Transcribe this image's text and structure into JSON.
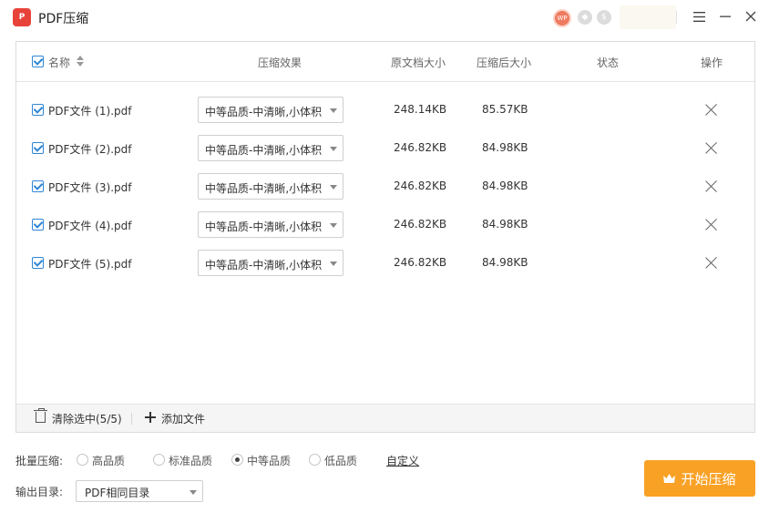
{
  "app": {
    "logo_text": "P",
    "title": "PDF压缩"
  },
  "titlebar": {
    "avatar_text": "WP",
    "menu_icon": "hamburger-icon",
    "minimize_icon": "minimize-icon",
    "close_icon": "close-icon"
  },
  "table": {
    "headers": {
      "name": "名称",
      "effect": "压缩效果",
      "orig_size": "原文档大小",
      "comp_size": "压缩后大小",
      "status": "状态",
      "action": "操作"
    },
    "rows": [
      {
        "name": "PDF文件 (1).pdf",
        "quality": "中等品质-中清晰,小体积",
        "orig": "248.14KB",
        "comp": "85.57KB",
        "status": ""
      },
      {
        "name": "PDF文件 (2).pdf",
        "quality": "中等品质-中清晰,小体积",
        "orig": "246.82KB",
        "comp": "84.98KB",
        "status": ""
      },
      {
        "name": "PDF文件 (3).pdf",
        "quality": "中等品质-中清晰,小体积",
        "orig": "246.82KB",
        "comp": "84.98KB",
        "status": ""
      },
      {
        "name": "PDF文件 (4).pdf",
        "quality": "中等品质-中清晰,小体积",
        "orig": "246.82KB",
        "comp": "84.98KB",
        "status": ""
      },
      {
        "name": "PDF文件 (5).pdf",
        "quality": "中等品质-中清晰,小体积",
        "orig": "246.82KB",
        "comp": "84.98KB",
        "status": ""
      }
    ],
    "footer": {
      "clear_label": "清除选中(5/5)",
      "add_label": "添加文件"
    }
  },
  "batch": {
    "label": "批量压缩:",
    "options": [
      {
        "label": "高品质",
        "selected": false
      },
      {
        "label": "标准品质",
        "selected": false
      },
      {
        "label": "中等品质",
        "selected": true
      },
      {
        "label": "低品质",
        "selected": false
      }
    ],
    "custom_label": "自定义"
  },
  "output": {
    "label": "输出目录:",
    "value": "PDF相同目录"
  },
  "start_button": {
    "label": "开始压缩"
  },
  "colors": {
    "accent": "#f9a125",
    "checkbox": "#2f86d6",
    "logo": "#e8433a"
  }
}
